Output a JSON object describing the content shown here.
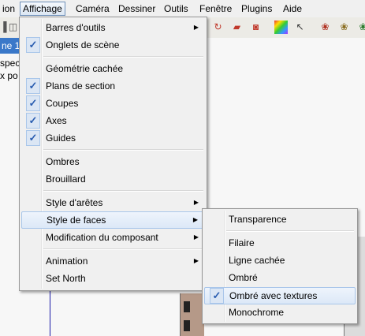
{
  "menubar": {
    "items": [
      "ion",
      "Affichage",
      "Caméra",
      "Dessiner",
      "Outils",
      "Fenêtre",
      "Plugins",
      "Aide"
    ]
  },
  "scene": {
    "tab_label": "ne 1 (",
    "text_lines": "spec\nx po"
  },
  "affichage_menu": {
    "items": [
      {
        "label": "Barres d'outils",
        "submenu": true,
        "checked": false
      },
      {
        "label": "Onglets de scène",
        "submenu": false,
        "checked": true
      },
      {
        "label": "Géométrie cachée",
        "submenu": false,
        "checked": false
      },
      {
        "label": "Plans de section",
        "submenu": false,
        "checked": true
      },
      {
        "label": "Coupes",
        "submenu": false,
        "checked": true
      },
      {
        "label": "Axes",
        "submenu": false,
        "checked": true
      },
      {
        "label": "Guides",
        "submenu": false,
        "checked": true
      },
      {
        "label": "Ombres",
        "submenu": false,
        "checked": false
      },
      {
        "label": "Brouillard",
        "submenu": false,
        "checked": false
      },
      {
        "label": "Style d'arêtes",
        "submenu": true,
        "checked": false
      },
      {
        "label": "Style de faces",
        "submenu": true,
        "checked": false,
        "highlighted": true
      },
      {
        "label": "Modification du composant",
        "submenu": true,
        "checked": false
      },
      {
        "label": "Animation",
        "submenu": true,
        "checked": false
      },
      {
        "label": "Set North",
        "submenu": false,
        "checked": false
      }
    ]
  },
  "faces_submenu": {
    "items": [
      {
        "label": "Transparence",
        "checked": false
      },
      {
        "label": "Filaire",
        "checked": false
      },
      {
        "label": "Ligne cachée",
        "checked": false
      },
      {
        "label": "Ombré",
        "checked": false
      },
      {
        "label": "Ombré avec textures",
        "checked": true,
        "highlighted": true
      },
      {
        "label": "Monochrome",
        "checked": false
      }
    ]
  },
  "glyphs": {
    "check": "✓",
    "arrow": "▶"
  }
}
